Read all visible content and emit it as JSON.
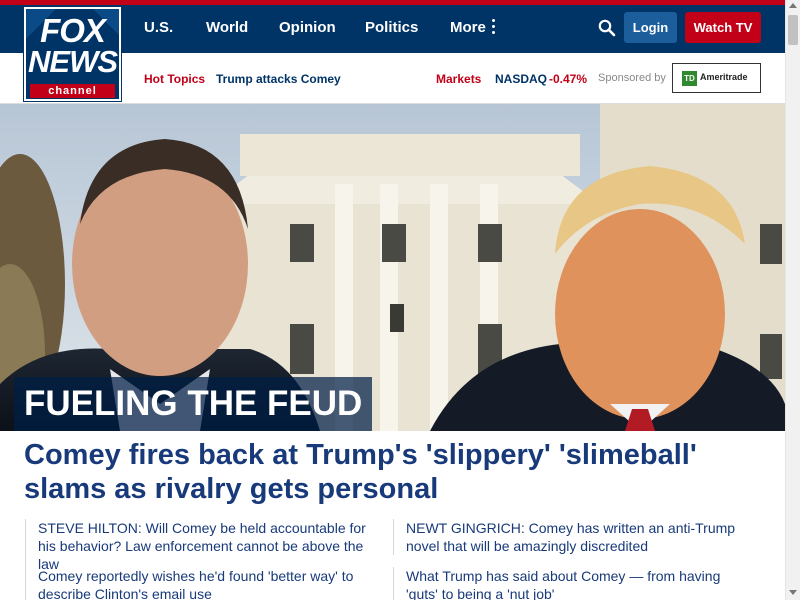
{
  "brand": {
    "line1": "FOX",
    "line2": "NEWS",
    "line3": "channel",
    "colors": {
      "navy": "#003366",
      "red": "#c20017",
      "headline": "#183a7a"
    }
  },
  "nav": {
    "items": [
      "U.S.",
      "World",
      "Opinion",
      "Politics",
      "More"
    ],
    "login_label": "Login",
    "watch_label": "Watch TV",
    "icons": {
      "search": "search-icon",
      "more": "kebab-icon"
    }
  },
  "subnav": {
    "hot_topics_label": "Hot Topics",
    "hot_topic_link": "Trump attacks Comey",
    "markets_label": "Markets",
    "index_name": "NASDAQ",
    "index_change": "-0.47%",
    "sponsored_label": "Sponsored by",
    "sponsor_logo_mark": "TD",
    "sponsor_name": "Ameritrade"
  },
  "hero": {
    "label": "FUELING THE FEUD",
    "headline": "Comey fires back at Trump's 'slippery' 'slimeball' slams as rivalry gets personal"
  },
  "related": [
    "STEVE HILTON: Will Comey be held accountable for his behavior? Law enforcement cannot be above the law",
    "NEWT GINGRICH: Comey has written an anti-Trump novel that will be amazingly discredited",
    "Comey reportedly wishes he'd found 'better way' to describe Clinton's email use",
    "What Trump has said about Comey — from having 'guts' to being a 'nut job'"
  ]
}
